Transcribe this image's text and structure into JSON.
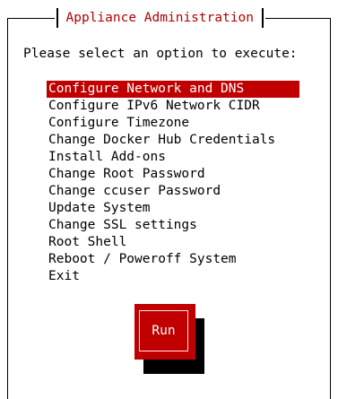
{
  "dialog": {
    "title": "Appliance Administration",
    "prompt": "Please select an option to execute:"
  },
  "menu": {
    "items": [
      {
        "label": "Configure Network and DNS",
        "selected": true
      },
      {
        "label": "Configure IPv6 Network CIDR",
        "selected": false
      },
      {
        "label": "Configure Timezone",
        "selected": false
      },
      {
        "label": "Change Docker Hub Credentials",
        "selected": false
      },
      {
        "label": "Install Add-ons",
        "selected": false
      },
      {
        "label": "Change Root Password",
        "selected": false
      },
      {
        "label": "Change ccuser Password",
        "selected": false
      },
      {
        "label": "Update System",
        "selected": false
      },
      {
        "label": "Change SSL settings",
        "selected": false
      },
      {
        "label": "Root Shell",
        "selected": false
      },
      {
        "label": "Reboot / Poweroff System",
        "selected": false
      },
      {
        "label": "Exit",
        "selected": false
      }
    ]
  },
  "buttons": {
    "run_label": "Run"
  },
  "colors": {
    "accent": "#c00000",
    "title": "#b40000",
    "background": "#ffffff",
    "text": "#000000"
  }
}
